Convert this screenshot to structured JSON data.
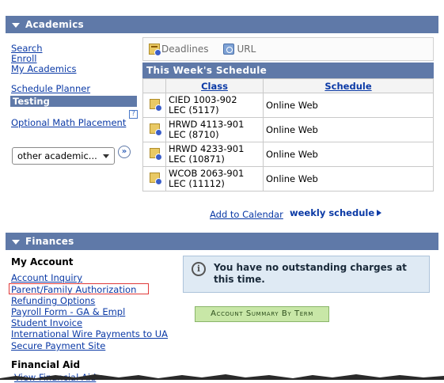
{
  "academics": {
    "header": "Academics",
    "nav": {
      "search": "Search",
      "enroll": "Enroll",
      "my_academics": "My Academics",
      "schedule_planner": "Schedule Planner",
      "testing": "Testing",
      "optional_math": "Optional Math Placement",
      "help": "?"
    },
    "select": {
      "value": "other academic...",
      "go": "»"
    },
    "pagelet": {
      "deadlines": "Deadlines",
      "url": "URL"
    },
    "schedule": {
      "title": "This Week's Schedule",
      "col_class": "Class",
      "col_schedule": "Schedule",
      "rows": [
        {
          "c1": "CIED 1003-902",
          "c2": "LEC (5117)",
          "sched": "Online Web"
        },
        {
          "c1": "HRWD 4113-901",
          "c2": "LEC (8710)",
          "sched": "Online Web"
        },
        {
          "c1": "HRWD 4233-901",
          "c2": "LEC (10871)",
          "sched": "Online Web"
        },
        {
          "c1": "WCOB 2063-901",
          "c2": "LEC (11112)",
          "sched": "Online Web"
        }
      ],
      "add_to_calendar": "Add to Calendar",
      "weekly": "weekly schedule"
    }
  },
  "finances": {
    "header": "Finances",
    "my_account": "My Account",
    "links": {
      "account_inquiry": "Account Inquiry",
      "parent_auth": "Parent/Family Authorization",
      "refunding": "Refunding Options",
      "payroll": "Payroll Form - GA & Empl",
      "invoice": "Student Invoice",
      "wire": "International Wire Payments to UA",
      "secure_pay": "Secure Payment Site"
    },
    "notice": "You have no outstanding charges at this time.",
    "summary_button": "Account Summary By Term",
    "financial_aid": "Financial Aid",
    "view_fa": "View Financial Aid"
  },
  "colors": {
    "header_bg": "#5f79a8",
    "link": "#0b3aa6",
    "notice_bg": "#dfeaf4",
    "button_bg": "#c8e7a7",
    "highlight": "#e03a3a"
  }
}
